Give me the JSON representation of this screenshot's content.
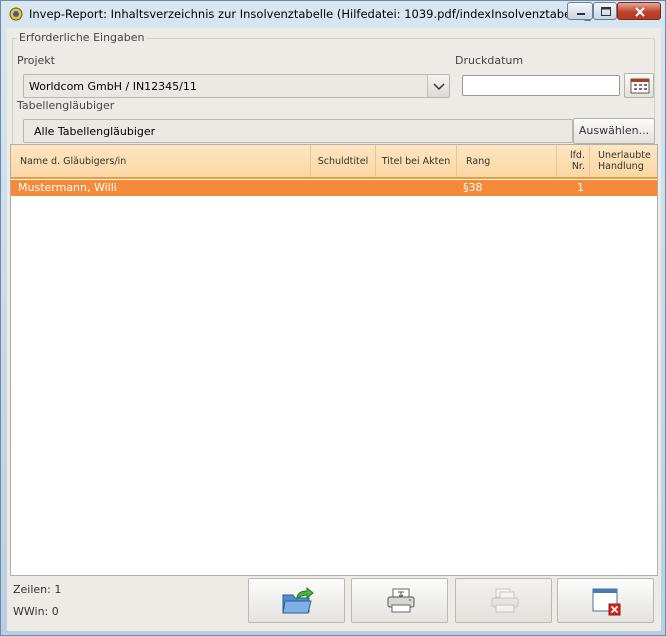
{
  "window": {
    "title": "Invep-Report: Inhaltsverzeichnis zur Insolvenztabelle    (Hilfedatei: 1039.pdf/indexInsolvenztabelle_..."
  },
  "form": {
    "group_title": "Erforderliche Eingaben",
    "projekt_label": "Projekt",
    "projekt_value": "Worldcom GmbH / IN12345/11",
    "druckdatum_label": "Druckdatum",
    "druckdatum_value": "",
    "tabellenglaeubiger_label": "Tabellengläubiger",
    "tabellenglaeubiger_value": "Alle Tabellengläubiger",
    "select_button": "Auswählen..."
  },
  "table": {
    "columns": [
      {
        "label": "Name d. Gläubigers/in"
      },
      {
        "label": "Schuldtitel"
      },
      {
        "label": "Titel bei Akten"
      },
      {
        "label": "Rang"
      },
      {
        "label": "lfd. Nr."
      },
      {
        "label": "Unerlaubte Handlung"
      }
    ],
    "col_lfd_1": "lfd.",
    "col_lfd_2": "Nr.",
    "col_uh_1": "Unerlaubte",
    "col_uh_2": "Handlung",
    "rows": [
      {
        "name": "Mustermann, Willi",
        "schuldtitel": "",
        "titel_bei_akten": "",
        "rang": "§38",
        "lfd_nr": "1",
        "unerlaubte_handlung": "",
        "selected": true
      }
    ]
  },
  "status": {
    "zeilen": "Zeilen: 1",
    "wwin": "WWin: 0"
  },
  "toolbar": {
    "buttons": [
      {
        "icon": "export-folder-icon",
        "enabled": true
      },
      {
        "icon": "printer-icon",
        "enabled": true
      },
      {
        "icon": "print-preview-icon",
        "enabled": false
      },
      {
        "icon": "close-window-icon",
        "enabled": true
      }
    ]
  },
  "colors": {
    "header_bg": "#fbd7a2",
    "selected_row": "#f48a3a",
    "accent_border": "#f29a3b"
  }
}
